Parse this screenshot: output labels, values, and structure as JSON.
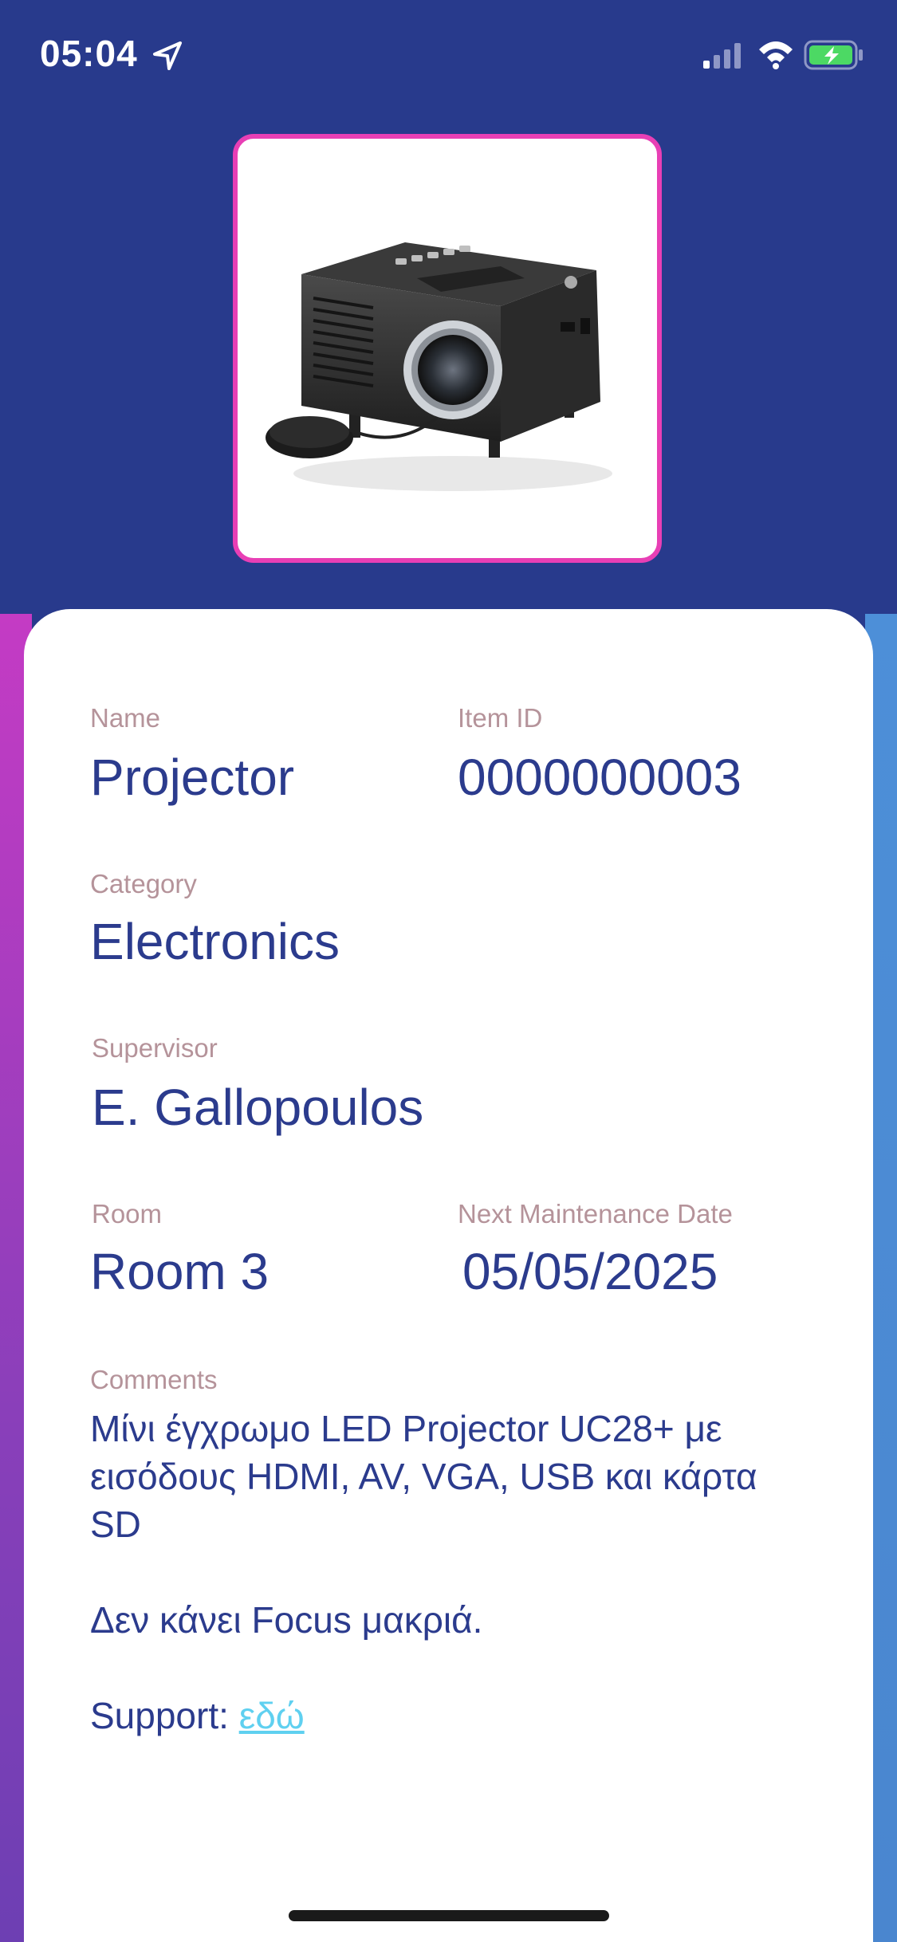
{
  "status_bar": {
    "time": "05:04"
  },
  "item": {
    "image_alt": "projector-photo",
    "name_label": "Name",
    "name_value": "Projector",
    "id_label": "Item ID",
    "id_value": "0000000003",
    "category_label": "Category",
    "category_value": "Electronics",
    "supervisor_label": "Supervisor",
    "supervisor_value": "E. Gallopoulos",
    "room_label": "Room",
    "room_value": "Room 3",
    "maintenance_label": "Next Maintenance Date",
    "maintenance_value": "05/05/2025",
    "comments_label": "Comments",
    "comments_line1": "Μίνι έγχρωμο LED Projector UC28+ με εισόδους HDMI, AV, VGA, USB και κάρτα SD",
    "comments_line2": "Δεν κάνει Focus μακριά.",
    "support_prefix": "Support: ",
    "support_link": "εδώ"
  },
  "colors": {
    "background": "#283a8c",
    "frame_border": "#e83fb5",
    "label": "#b5939a",
    "value": "#2b3b8d",
    "link": "#5fd0f0"
  }
}
